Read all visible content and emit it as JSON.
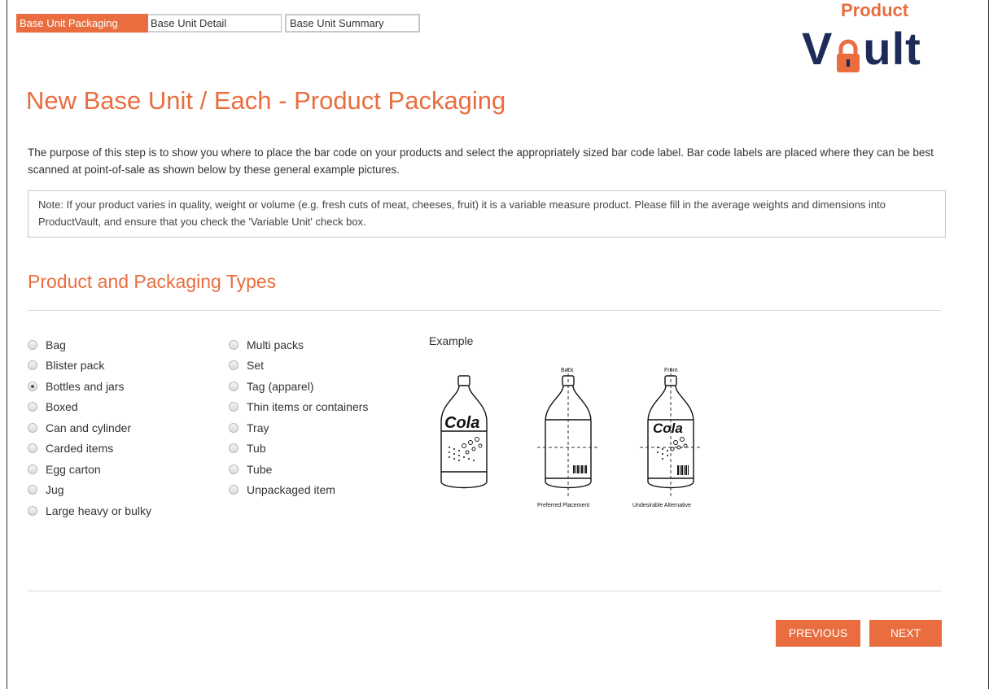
{
  "steps": [
    {
      "label": "Base Unit Packaging",
      "active": true
    },
    {
      "label": "Base Unit Detail",
      "active": false
    },
    {
      "label": "Base Unit Summary",
      "active": false
    }
  ],
  "logo": {
    "top": "Product",
    "main_prefix": "V",
    "main_suffix": "ult"
  },
  "page_title": "New Base Unit / Each - Product Packaging",
  "intro_text": "The purpose of this step is to show you where to place the bar code on your products and select the appropriately sized bar code label. Bar code labels are placed where they can be best scanned at point-of-sale as shown below by these general example pictures.",
  "note_text": "Note: If your product varies in quality, weight or volume (e.g. fresh cuts of meat, cheeses, fruit) it is a variable measure product. Please fill in the average weights and dimensions into ProductVault, and ensure that you check the 'Variable Unit' check box.",
  "section_title": "Product and Packaging Types",
  "packaging_types_col1": [
    "Bag",
    "Blister pack",
    "Bottles and jars",
    "Boxed",
    "Can and cylinder",
    "Carded items",
    "Egg carton",
    "Jug",
    "Large heavy or bulky"
  ],
  "packaging_types_col2": [
    "Multi packs",
    "Set",
    "Tag (apparel)",
    "Thin items or containers",
    "Tray",
    "Tub",
    "Tube",
    "Unpackaged item"
  ],
  "selected_type": "Bottles and jars",
  "example": {
    "label": "Example",
    "brand": "Cola",
    "back_label": "Back",
    "front_label": "Front",
    "preferred_caption": "Preferred Placement",
    "undesirable_caption": "Undesirable Alternative"
  },
  "buttons": {
    "previous": "PREVIOUS",
    "next": "NEXT"
  },
  "colors": {
    "accent": "#e96d3f",
    "logo_navy": "#1c2b57"
  }
}
